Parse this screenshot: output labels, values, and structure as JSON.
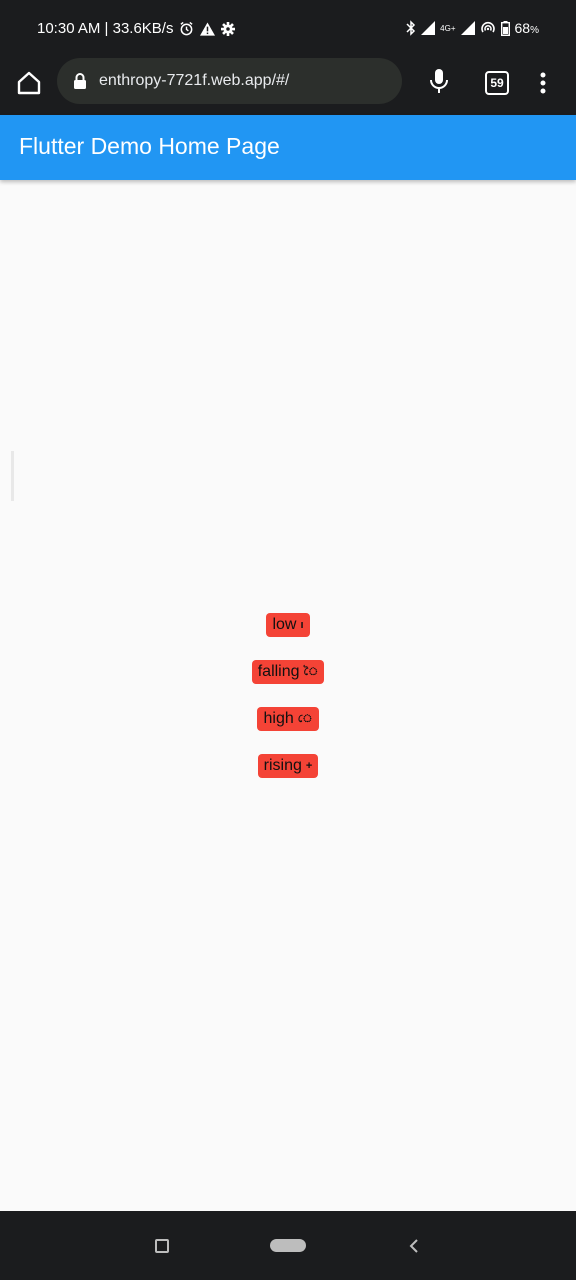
{
  "status_bar": {
    "time_speed": "10:30 AM | 33.6KB/s",
    "network_label": "4G+",
    "battery": "68",
    "battery_unit": "%"
  },
  "browser": {
    "url": "enthropy-7721f.web.app/#/",
    "tab_count": "59"
  },
  "app_bar": {
    "title": "Flutter Demo Home Page"
  },
  "chips": [
    {
      "label": "low",
      "glyph": "ı"
    },
    {
      "label": "falling",
      "glyph": "ৈ"
    },
    {
      "label": "high",
      "glyph": "ে"
    },
    {
      "label": "rising",
      "glyph": "+"
    }
  ],
  "colors": {
    "app_bar": "#2196f3",
    "chip": "#f44336",
    "system_bars": "#1b1c1e",
    "background": "#fafafa"
  }
}
